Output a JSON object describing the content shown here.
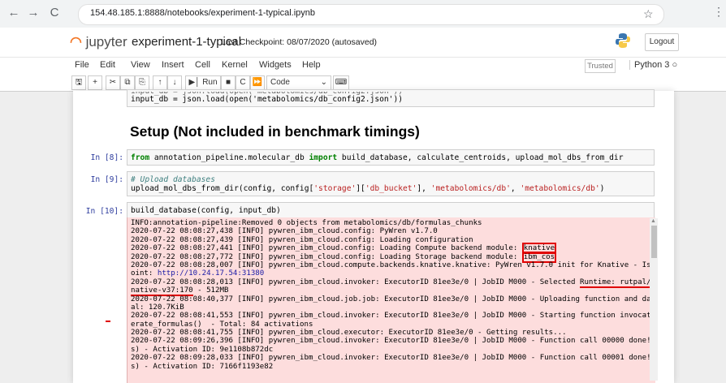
{
  "browser": {
    "url": "154.48.185.1:8888/notebooks/experiment-1-typical.ipynb",
    "back_icon": "←",
    "forward_icon": "→",
    "reload_icon": "C",
    "star_icon": "☆",
    "menu_icon": "⋮"
  },
  "header": {
    "logo_text": "jupyter",
    "notebook_name": "experiment-1-typical",
    "checkpoint": "Last Checkpoint: 08/07/2020  (autosaved)",
    "logout_label": "Logout"
  },
  "menubar": {
    "items": [
      "File",
      "Edit",
      "View",
      "Insert",
      "Cell",
      "Kernel",
      "Widgets",
      "Help"
    ],
    "trusted_label": "Trusted",
    "kernel_label": "Python 3"
  },
  "toolbar": {
    "run_label": "Run",
    "cell_type": "Code"
  },
  "cells": {
    "cell0_line1": "input_db = json.load(open('metabolomics/db_config2.json'))",
    "cell0_partial": "input_db = json.load(open('metabolomics/db_config2.json'))",
    "heading": "Setup (Not included in benchmark timings)",
    "cell8_prompt": "In [8]:",
    "cell8_kw_from": "from",
    "cell8_module": " annotation_pipeline.molecular_db ",
    "cell8_kw_import": "import",
    "cell8_rest": " build_database, calculate_centroids, upload_mol_dbs_from_dir",
    "cell9_prompt": "In [9]:",
    "cell9_comment": "# Upload databases",
    "cell9_code_a": "upload_mol_dbs_from_dir(config, config[",
    "cell9_str1": "'storage'",
    "cell9_code_b": "][",
    "cell9_str2": "'db_bucket'",
    "cell9_code_c": "], ",
    "cell9_str3": "'metabolomics/db'",
    "cell9_code_d": ", ",
    "cell9_str4": "'metabolomics/db'",
    "cell9_code_e": ")",
    "cell10_prompt": "In [10]:",
    "cell10_code": "build_database(config, input_db)"
  },
  "output": {
    "l1": "INFO:annotation-pipeline:Removed 0 objects from metabolomics/db/formulas_chunks",
    "l2": "2020-07-22 08:08:27,438 [INFO] pywren_ibm_cloud.config: PyWren v1.7.0",
    "l3": "2020-07-22 08:08:27,439 [INFO] pywren_ibm_cloud.config: Loading configuration",
    "l4a": "2020-07-22 08:08:27,441 [INFO] pywren_ibm_cloud.config: Loading Compute backend module: ",
    "l4b": "knative",
    "l5a": "2020-07-22 08:08:27,772 [INFO] pywren_ibm_cloud.config: Loading Storage backend module: ",
    "l5b": "ibm_cos",
    "l6": "2020-07-22 08:08:28,007 [INFO] pywren_ibm_cloud.compute.backends.knative.knative: PyWren v1.7.0 init for Knative - Istio Endp",
    "l7a": "oint: ",
    "l7b": "http://10.24.17.54:31380",
    "l8a": "2020-07-22 08:08:28,013 [INFO] pywren_ibm_cloud.invoker: ExecutorID 81ee3e/0 | JobID M000 - Selected ",
    "l8b": "Runtime: rutpal/pywren-k",
    "l9a": "native-v37:170",
    "l9b": " - 512MB",
    "l10": "2020-07-22 08:08:40,377 [INFO] pywren_ibm_cloud.job.job: ExecutorID 81ee3e/0 | JobID M000 - Uploading function and data - Tot",
    "l11": "al: 120.7KiB",
    "l12": "2020-07-22 08:08:41,553 [INFO] pywren_ibm_cloud.invoker: ExecutorID 81ee3e/0 | JobID M000 - Starting function invocation: gen",
    "l13": "erate_formulas()  - Total: 84 activations",
    "l14": "2020-07-22 08:08:41,755 [INFO] pywren_ibm_cloud.executor: ExecutorID 81ee3e/0 - Getting results...",
    "l15": "2020-07-22 08:09:26,396 [INFO] pywren_ibm_cloud.invoker: ExecutorID 81ee3e/0 | JobID M000 - Function call 00000 done! (44.837",
    "l16": "s) - Activation ID: 9e1108b872dc",
    "l17": "2020-07-22 08:09:28,033 [INFO] pywren_ibm_cloud.invoker: ExecutorID 81ee3e/0 | JobID M000 - Function call 00001 done! (46.471",
    "l18": "s) - Activation ID: 7166f1193e82"
  },
  "colors": {
    "output_bg": "#fddddd",
    "highlight": "#e00000",
    "prompt": "#303f9f"
  }
}
